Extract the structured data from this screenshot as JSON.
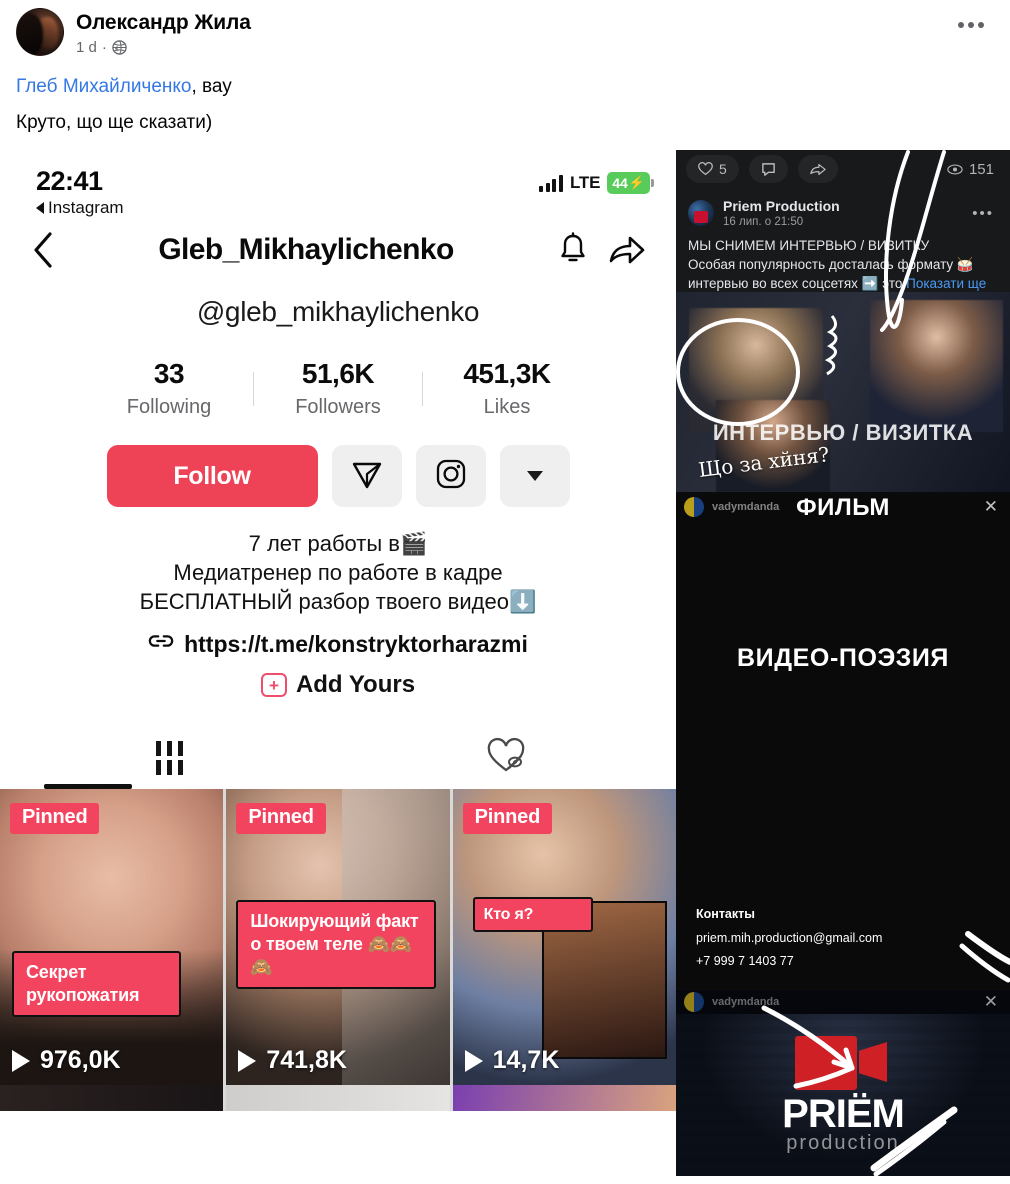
{
  "post": {
    "author": "Олександр Жила",
    "time": "1 d",
    "separator": "·",
    "privacy_icon": "globe-icon",
    "menu_icon": "more-options-icon",
    "text_line1_mention": "Глеб Михайличенко",
    "text_line1_rest": ", вау",
    "text_line2": "Круто, що ще сказати)"
  },
  "instagram": {
    "status_bar": {
      "time": "22:41",
      "back_app": "Instagram",
      "network": "LTE",
      "battery": "44",
      "battery_bolt": "⚡"
    },
    "nav": {
      "back_icon": "chevron-left-icon",
      "title": "Gleb_Mikhaylichenko",
      "bell_icon": "bell-icon",
      "share_icon": "share-arrow-icon"
    },
    "handle": "@gleb_mikhaylichenko",
    "stats": [
      {
        "value": "33",
        "label": "Following"
      },
      {
        "value": "51,6K",
        "label": "Followers"
      },
      {
        "value": "451,3K",
        "label": "Likes"
      }
    ],
    "actions": {
      "follow_label": "Follow",
      "message_icon": "paper-plane-icon",
      "instagram_icon": "instagram-icon",
      "dropdown_icon": "caret-down-icon",
      "follow_color": "#ee4356"
    },
    "bio": {
      "line1": "7 лет работы в🎬",
      "line2": "Медиатренер по работе в кадре",
      "line3": "БЕСПЛАТНЫЙ разбор твоего видео⬇️",
      "link_icon": "link-icon",
      "link": "https://t.me/konstryktorharazmi",
      "add_yours": "Add Yours",
      "add_yours_icon": "add-yours-icon"
    },
    "tabs": {
      "grid_icon": "grid-tab-icon",
      "hidden_likes_icon": "heart-hidden-icon",
      "active": "grid"
    },
    "videos": [
      {
        "badge": "Pinned",
        "caption": "Секрет рукопожатия",
        "views": "976,0K",
        "play_icon": "play-icon"
      },
      {
        "badge": "Pinned",
        "caption": "Шокирующий факт о твоем теле 🙈🙈🙈",
        "views": "741,8K",
        "play_icon": "play-icon"
      },
      {
        "badge": "Pinned",
        "caption": "Кто я?",
        "views": "14,7K",
        "play_icon": "play-icon"
      }
    ]
  },
  "right_column": {
    "fb_post": {
      "like_icon": "heart-icon",
      "like_count": "5",
      "comment_icon": "comment-icon",
      "share_icon": "share-icon",
      "views_icon": "eye-icon",
      "views_count": "151",
      "page_name": "Priem Production",
      "timestamp": "16 лип. о 21:50",
      "menu_icon": "more-options-icon",
      "body_line1": "МЫ СНИМЕМ ИНТЕРВЬЮ / ВИЗИТКУ",
      "body_line2": "Особая популярность досталась формату 🥁",
      "body_line3": "интервью во всех соцсетях ➡️ это",
      "see_more": "Показати ще",
      "overlay_title": "ИНТЕРВЬЮ / ВИЗИТКА",
      "handwriting": "Що за хйня?"
    },
    "story_video": {
      "username": "vadymdanda",
      "close_icon": "close-icon",
      "top_title": "ФИЛЬМ",
      "center_title": "ВИДЕО-ПОЭЗИЯ",
      "contacts_title": "Контакты",
      "email": "priem.mih.production@gmail.com",
      "phone": "+7 999 7 1403 77"
    },
    "story_logo": {
      "username": "vadymdanda",
      "close_icon": "close-icon",
      "brand": "PRIËM",
      "sub_brand": "production",
      "logo_icon": "video-camera-icon",
      "logo_color": "#cf2026"
    }
  }
}
